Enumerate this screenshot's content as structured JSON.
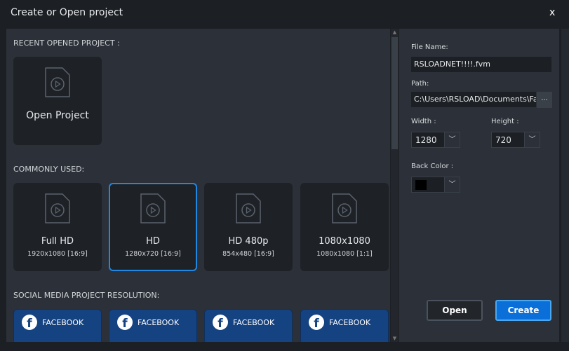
{
  "title": "Create or Open project",
  "close": "x",
  "recent": {
    "heading": "RECENT OPENED PROJECT :",
    "open_label": "Open Project"
  },
  "common": {
    "heading": "COMMONLY USED:",
    "presets": [
      {
        "name": "Full HD",
        "res": "1920x1080 [16:9]"
      },
      {
        "name": "HD",
        "res": "1280x720 [16:9]",
        "selected": true
      },
      {
        "name": "HD 480p",
        "res": "854x480 [16:9]"
      },
      {
        "name": "1080x1080",
        "res": "1080x1080 [1:1]"
      }
    ]
  },
  "social": {
    "heading": "SOCIAL MEDIA PROJECT RESOLUTION:",
    "items": [
      "FACEBOOK",
      "FACEBOOK",
      "FACEBOOK",
      "FACEBOOK"
    ],
    "icon": "f"
  },
  "form": {
    "file_name_label": "File Name:",
    "file_name": "RSLOADNET!!!!.fvm",
    "path_label": "Path:",
    "path": "C:\\Users\\RSLOAD\\Documents\\Fa",
    "browse": "...",
    "width_label": "Width :",
    "width": "1280",
    "height_label": "Height :",
    "height": "720",
    "back_color_label": "Back Color :",
    "back_color": "#000000"
  },
  "buttons": {
    "open": "Open",
    "create": "Create"
  },
  "colors": {
    "accent": "#1e88e5",
    "create": "#0a6fd8",
    "facebook": "#154280"
  }
}
